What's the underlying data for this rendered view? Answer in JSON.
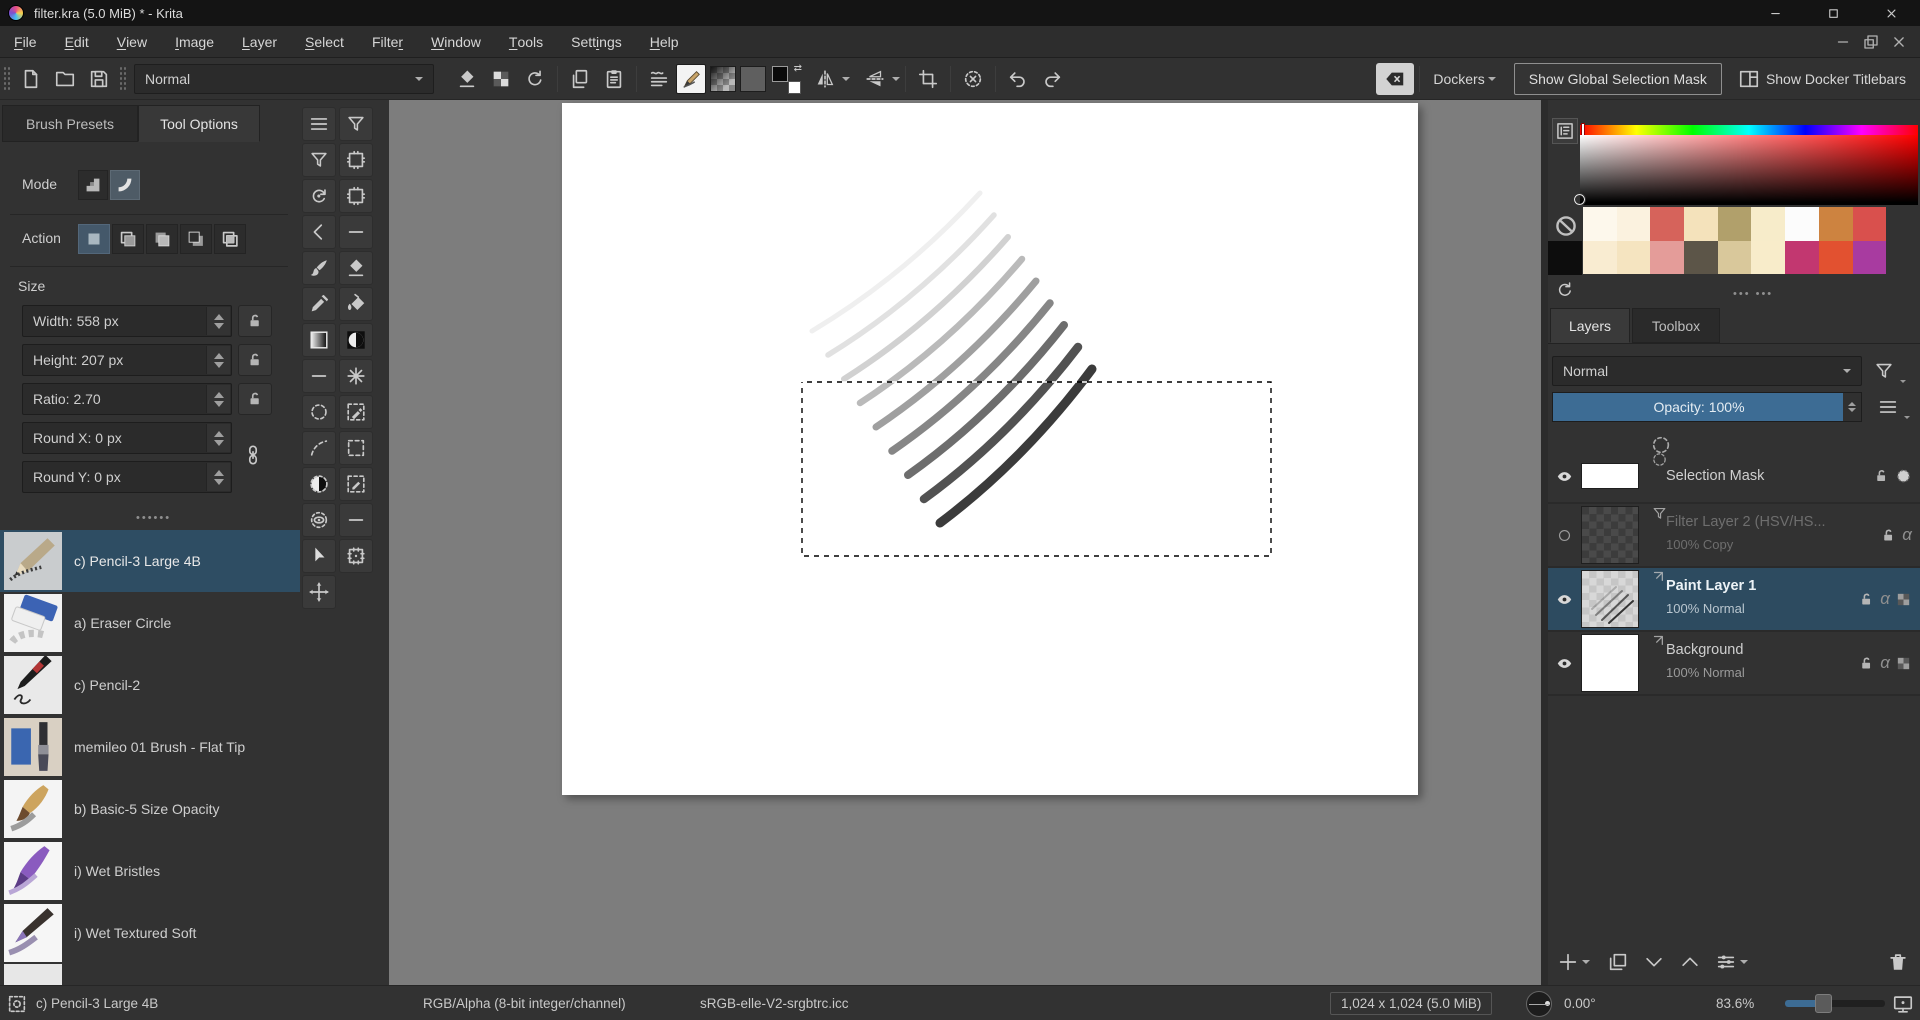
{
  "title_bar": {
    "title": "filter.kra (5.0 MiB) * - Krita"
  },
  "menu_bar": {
    "items": [
      {
        "pre": "",
        "accel": "F",
        "post": "ile"
      },
      {
        "pre": "",
        "accel": "E",
        "post": "dit"
      },
      {
        "pre": "",
        "accel": "V",
        "post": "iew"
      },
      {
        "pre": "",
        "accel": "I",
        "post": "mage"
      },
      {
        "pre": "",
        "accel": "L",
        "post": "ayer"
      },
      {
        "pre": "",
        "accel": "S",
        "post": "elect"
      },
      {
        "pre": "Filte",
        "accel": "r",
        "post": ""
      },
      {
        "pre": "",
        "accel": "W",
        "post": "indow"
      },
      {
        "pre": "",
        "accel": "T",
        "post": "ools"
      },
      {
        "pre": "Sett",
        "accel": "i",
        "post": "ngs"
      },
      {
        "pre": "",
        "accel": "H",
        "post": "elp"
      }
    ]
  },
  "toolbar": {
    "blend_mode": "Normal",
    "dockers_label": "Dockers",
    "show_selection_mask_label": "Show Global Selection Mask",
    "show_docker_titlebars_label": "Show Docker Titlebars"
  },
  "left_panel": {
    "tabs": [
      {
        "label": "Brush Presets"
      },
      {
        "label": "Tool Options"
      }
    ],
    "mode_label": "Mode",
    "action_label": "Action",
    "size_label": "Size",
    "fields": [
      {
        "label": "Width: 558 px"
      },
      {
        "label": "Height: 207 px"
      },
      {
        "label": "Ratio: 2.70"
      },
      {
        "label": "Round X: 0 px"
      },
      {
        "label": "Round Y: 0 px"
      }
    ],
    "brush_presets": [
      {
        "label": "c) Pencil-3 Large 4B",
        "thumb": "pencil3",
        "selected": true
      },
      {
        "label": "a) Eraser Circle",
        "thumb": "eraser",
        "selected": false
      },
      {
        "label": "c) Pencil-2",
        "thumb": "pencil2",
        "selected": false
      },
      {
        "label": "memileo 01 Brush - Flat Tip",
        "thumb": "memileo",
        "selected": false
      },
      {
        "label": "b) Basic-5 Size Opacity",
        "thumb": "basic5",
        "selected": false
      },
      {
        "label": "i) Wet Bristles",
        "thumb": "wetbristles",
        "selected": false
      },
      {
        "label": "i) Wet Textured Soft",
        "thumb": "wettextured",
        "selected": false
      }
    ]
  },
  "toolbox": {
    "tools": [
      {
        "id": "docker-menu",
        "icon": "hamburger"
      },
      {
        "id": "filter-a",
        "icon": "funnel"
      },
      {
        "id": "filter-b",
        "icon": "funnel"
      },
      {
        "id": "transform-a",
        "icon": "frame"
      },
      {
        "id": "rotate",
        "icon": "rotate"
      },
      {
        "id": "transform-b",
        "icon": "frame"
      },
      {
        "id": "back",
        "icon": "chevron"
      },
      {
        "id": "dash-a",
        "icon": "dash"
      },
      {
        "id": "freehand-brush",
        "icon": "brush"
      },
      {
        "id": "eraser",
        "icon": "eraser-diamond"
      },
      {
        "id": "color-sampler",
        "icon": "eyedropper"
      },
      {
        "id": "fill",
        "icon": "fill"
      },
      {
        "id": "gradient",
        "icon": "gradient-sq"
      },
      {
        "id": "contrast",
        "icon": "contrast"
      },
      {
        "id": "dash-b",
        "icon": "dash"
      },
      {
        "id": "magic-wand",
        "icon": "wand"
      },
      {
        "id": "ellipse-select",
        "icon": "dashed-circle"
      },
      {
        "id": "picker-select",
        "icon": "dashed-picker"
      },
      {
        "id": "freehand-select",
        "icon": "dashed-curve"
      },
      {
        "id": "rect-select",
        "icon": "dashed-rect"
      },
      {
        "id": "similar-select",
        "icon": "bw-circle"
      },
      {
        "id": "edit-select",
        "icon": "dashed-pencil"
      },
      {
        "id": "magnetic-select",
        "icon": "dashed-eye"
      },
      {
        "id": "dash-c",
        "icon": "dash"
      },
      {
        "id": "pointer",
        "icon": "pointer"
      },
      {
        "id": "crop",
        "icon": "crop-frame"
      },
      {
        "id": "move",
        "icon": "move"
      }
    ]
  },
  "color_docker": {
    "swatches_row1": [
      "#fdf8ec",
      "#fbf2df",
      "#d6635b",
      "#f4e2bb",
      "#b1a06b",
      "#f7ecca",
      "#fcfcfc",
      "#cd8340",
      "#d9504d"
    ],
    "swatches_row2": [
      "#f9ecd1",
      "#f5e4c0",
      "#e49c99",
      "#5c5548",
      "#d9c89b",
      "#f8ecca",
      "#c23770",
      "#e25130",
      "#a83ba0"
    ]
  },
  "layer_docker": {
    "tabs": [
      {
        "label": "Layers"
      },
      {
        "label": "Toolbox"
      }
    ],
    "blend_mode": "Normal",
    "opacity_label": "Opacity: 100%",
    "layers": [
      {
        "name": "Selection Mask",
        "subtitle": "",
        "badge": "badge-circle",
        "thumb": "white-wide",
        "visible": true,
        "dimmed": false,
        "selected": false,
        "icons": [
          "lock",
          "selcircle"
        ]
      },
      {
        "name": "Filter Layer 2 (HSV/HS...",
        "subtitle": "100% Copy",
        "badge": "funnel",
        "thumb": "checker-dark",
        "visible": false,
        "dimmed": true,
        "selected": false,
        "icons": [
          "lock",
          "alpha"
        ]
      },
      {
        "name": "Paint Layer 1",
        "subtitle": "100% Normal",
        "badge": "badge-corner",
        "thumb": "checker-strokes",
        "visible": true,
        "dimmed": false,
        "selected": true,
        "icons": [
          "lock",
          "alpha",
          "checker"
        ]
      },
      {
        "name": "Background",
        "subtitle": "100% Normal",
        "badge": "badge-corner",
        "thumb": "white",
        "visible": true,
        "dimmed": false,
        "selected": false,
        "icons": [
          "lock",
          "alpha",
          "checker"
        ]
      }
    ]
  },
  "status_bar": {
    "brush_name": "c) Pencil-3 Large 4B",
    "color_model": "RGB/Alpha (8-bit integer/channel)",
    "color_profile": "sRGB-elle-V2-srgbtrc.icc",
    "memory": "1,024 x 1,024 (5.0 MiB)",
    "rotation": "0.00°",
    "zoom": "83.6%"
  },
  "colors": {
    "selection_accent": "#2e4d63",
    "opacity_fill": "#3d6c94",
    "canvas_surround": "#7d7d7d"
  }
}
